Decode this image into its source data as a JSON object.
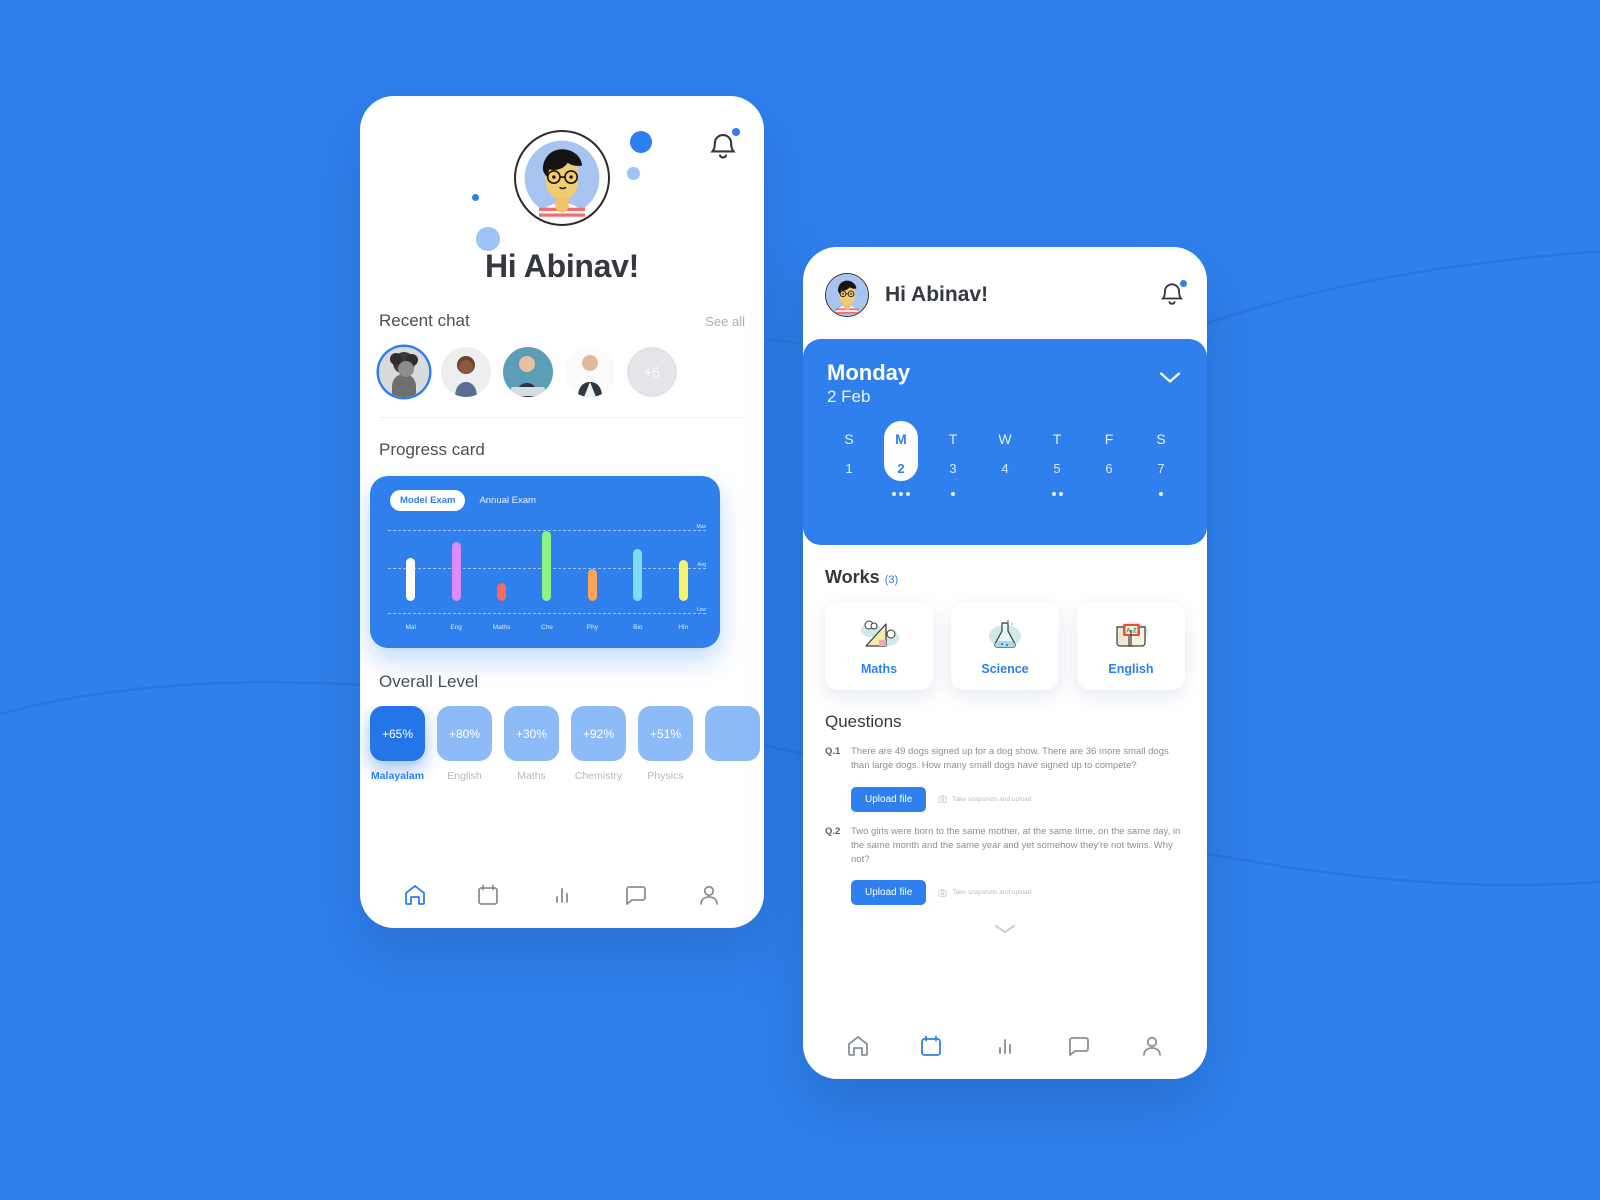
{
  "theme": {
    "brand_blue": "#2f80ed",
    "background": "#2f80ed",
    "card_white": "#ffffff",
    "muted_text": "#a9adb5",
    "dark_text": "#35393f"
  },
  "phone_home": {
    "notification_icon": "bell-icon",
    "avatar": "student-avatar",
    "greeting": "Hi Abinav!",
    "recent_chat": {
      "title": "Recent chat",
      "see_all": "See all",
      "avatars": [
        {
          "name": "chat-avatar-1",
          "active": true
        },
        {
          "name": "chat-avatar-2",
          "active": false
        },
        {
          "name": "chat-avatar-3",
          "active": false
        },
        {
          "name": "chat-avatar-4",
          "active": false
        }
      ],
      "more_label": "+5"
    },
    "progress_card": {
      "title": "Progress card",
      "tabs": [
        {
          "label": "Model Exam",
          "active": true
        },
        {
          "label": "Annual Exam",
          "active": false
        }
      ]
    },
    "overall_level": {
      "title": "Overall Level",
      "items": [
        {
          "value": "+65%",
          "subject": "Malayalam",
          "active": true
        },
        {
          "value": "+80%",
          "subject": "English",
          "active": false
        },
        {
          "value": "+30%",
          "subject": "Maths",
          "active": false
        },
        {
          "value": "+92%",
          "subject": "Chemistry",
          "active": false
        },
        {
          "value": "+51%",
          "subject": "Physics",
          "active": false
        },
        {
          "value": "",
          "subject": "",
          "active": false
        }
      ]
    },
    "tabbar": [
      {
        "icon": "home-icon",
        "label": "Home",
        "active": true
      },
      {
        "icon": "calendar-icon",
        "label": "Calendar",
        "active": false
      },
      {
        "icon": "bar-chart-icon",
        "label": "Stats",
        "active": false
      },
      {
        "icon": "chat-icon",
        "label": "Chat",
        "active": false
      },
      {
        "icon": "profile-icon",
        "label": "Profile",
        "active": false
      }
    ]
  },
  "phone_works": {
    "avatar": "student-avatar",
    "greeting": "Hi Abinav!",
    "notification_icon": "bell-icon",
    "calendar": {
      "day_name": "Monday",
      "date_label": "2 Feb",
      "expand_icon": "chevron-down-icon",
      "days": [
        {
          "weekday": "S",
          "number": "1",
          "selected": false,
          "events": 0
        },
        {
          "weekday": "M",
          "number": "2",
          "selected": true,
          "events": 3
        },
        {
          "weekday": "T",
          "number": "3",
          "selected": false,
          "events": 1
        },
        {
          "weekday": "W",
          "number": "4",
          "selected": false,
          "events": 0
        },
        {
          "weekday": "T",
          "number": "5",
          "selected": false,
          "events": 2
        },
        {
          "weekday": "F",
          "number": "6",
          "selected": false,
          "events": 0
        },
        {
          "weekday": "S",
          "number": "7",
          "selected": false,
          "events": 1
        }
      ]
    },
    "works": {
      "title": "Works",
      "count": "(3)",
      "items": [
        {
          "label": "Maths",
          "icon": "triangle-ruler-icon"
        },
        {
          "label": "Science",
          "icon": "flask-icon"
        },
        {
          "label": "English",
          "icon": "az-book-icon"
        }
      ]
    },
    "questions": {
      "title": "Questions",
      "items": [
        {
          "number": "Q.1",
          "text": "There are 49 dogs signed up for a dog show. There are 36 more small dogs than large dogs. How many small dogs have signed up to compete?",
          "upload_label": "Upload file",
          "snapshot_label": "Take snapshots and upload",
          "snapshot_icon": "camera-icon"
        },
        {
          "number": "Q.2",
          "text": "Two girls were born to the same mother, at the same time, on the same day, in the same month and the same year and yet somehow they're not twins. Why not?",
          "upload_label": "Upload file",
          "snapshot_label": "Take snapshots and upload",
          "snapshot_icon": "camera-icon"
        }
      ],
      "more_icon": "chevron-down-icon"
    },
    "tabbar": [
      {
        "icon": "home-icon",
        "label": "Home",
        "active": false
      },
      {
        "icon": "calendar-icon",
        "label": "Calendar",
        "active": true
      },
      {
        "icon": "bar-chart-icon",
        "label": "Stats",
        "active": false
      },
      {
        "icon": "chat-icon",
        "label": "Chat",
        "active": false
      },
      {
        "icon": "profile-icon",
        "label": "Profile",
        "active": false
      }
    ]
  },
  "chart_data": {
    "type": "bar",
    "title": "Progress card",
    "subtitle": "Model Exam",
    "categories": [
      "Mal",
      "Eng",
      "Maths",
      "Che",
      "Phy",
      "Bio",
      "Hin"
    ],
    "values": [
      62,
      80,
      34,
      92,
      50,
      72,
      60
    ],
    "base": [
      14,
      14,
      14,
      14,
      14,
      14,
      14
    ],
    "colors": [
      "#ffffff",
      "#dd8bf8",
      "#fc6a63",
      "#8ff285",
      "#fba55a",
      "#7fdcfb",
      "#f4f36a"
    ],
    "ylabel": "",
    "xlabel": "",
    "ylim": [
      0,
      100
    ],
    "gridlines": [
      {
        "label": "Max",
        "value": 92
      },
      {
        "label": "Avg",
        "value": 50
      },
      {
        "label": "Low",
        "value": 0
      }
    ],
    "grid": true,
    "legend": false
  }
}
